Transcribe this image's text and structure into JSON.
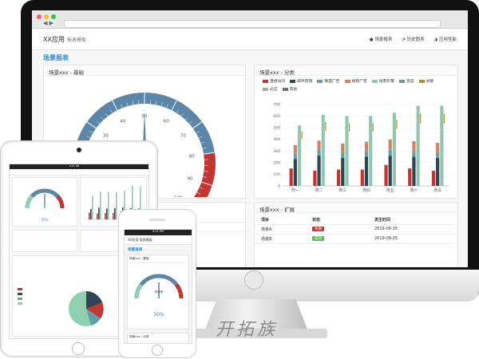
{
  "app": {
    "title": "XX应用",
    "subtitle": "报表模板",
    "header_links": [
      "场景报表",
      "历史图表",
      "应用性能"
    ],
    "section_title": "场景报表"
  },
  "colors": {
    "accent": "#2a8bd6",
    "gauge_blue": "#5b86a8",
    "gauge_green": "#8fd0b0",
    "gauge_red": "#c23531"
  },
  "gauge_panel": {
    "title": "场景xxx - 基础",
    "center_label": "完成率",
    "tick_labels": [
      "0",
      "10",
      "20",
      "30",
      "40",
      "50",
      "60",
      "70",
      "80",
      "90",
      "100"
    ],
    "value_percent": 50
  },
  "bar_panel": {
    "title": "场景xxx - 分类"
  },
  "table_panel": {
    "title": "场景xxx - 扩展",
    "columns": [
      "项目",
      "状态",
      "发生时间"
    ],
    "rows": [
      {
        "name": "场景A",
        "status": "失败",
        "status_color": "#c23531",
        "date": "2019-08-25"
      },
      {
        "name": "场景B",
        "status": "成功",
        "status_color": "#5cb85c",
        "date": "2019-08-25"
      }
    ]
  },
  "chart_data": {
    "type": "bar",
    "categories": [
      "周一",
      "周二",
      "周三",
      "周四",
      "周五",
      "周六",
      "周日"
    ],
    "ylim": [
      0,
      700
    ],
    "yticks": [
      "0",
      "100",
      "200",
      "300",
      "400",
      "500",
      "600",
      "700"
    ],
    "legend_placement": "top",
    "series": [
      {
        "name": "直接访问",
        "color": "#c23531",
        "values": [
          150,
          130,
          140,
          140,
          180,
          150,
          130
        ]
      },
      {
        "name": "邮件营销",
        "color": "#2f4554",
        "values": [
          230,
          260,
          240,
          250,
          260,
          250,
          240
        ]
      },
      {
        "name": "联盟广告",
        "color": "#61a0a8",
        "values": [
          0,
          0,
          0,
          0,
          0,
          0,
          0
        ],
        "stack_part": [
          50,
          50,
          50,
          50,
          50,
          50,
          50
        ]
      },
      {
        "name": "视频广告",
        "color": "#d48265",
        "values": [
          0,
          0,
          0,
          0,
          0,
          0,
          0
        ],
        "stack_part": [
          70,
          80,
          75,
          80,
          90,
          85,
          80
        ]
      },
      {
        "name": "搜索引擎",
        "color": "#91c7ae",
        "values": [
          520,
          610,
          600,
          600,
          630,
          740,
          720
        ]
      },
      {
        "name": "百度",
        "color": "#749f83",
        "values": [
          0,
          0,
          0,
          0,
          0,
          0,
          0
        ]
      },
      {
        "name": "谷歌",
        "color": "#ca8622",
        "values": [
          0,
          0,
          0,
          0,
          0,
          0,
          0
        ]
      },
      {
        "name": "必应",
        "color": "#bda29a",
        "values": [
          0,
          0,
          0,
          0,
          0,
          0,
          0
        ]
      },
      {
        "name": "其他",
        "color": "#6e7074",
        "values": [
          0,
          0,
          0,
          0,
          0,
          0,
          0
        ]
      }
    ]
  },
  "tablet": {
    "time": "4:21 PM",
    "percent": "50%"
  },
  "phone": {
    "time": "4:21 PM",
    "header": "XX应用 报表模板",
    "section_title": "场景报表",
    "panel1": "场景xxx - 基础",
    "gauge_label": "完成率",
    "percent": "50%",
    "panel2": "场景xxx - 分类"
  },
  "watermark": "开拓族"
}
